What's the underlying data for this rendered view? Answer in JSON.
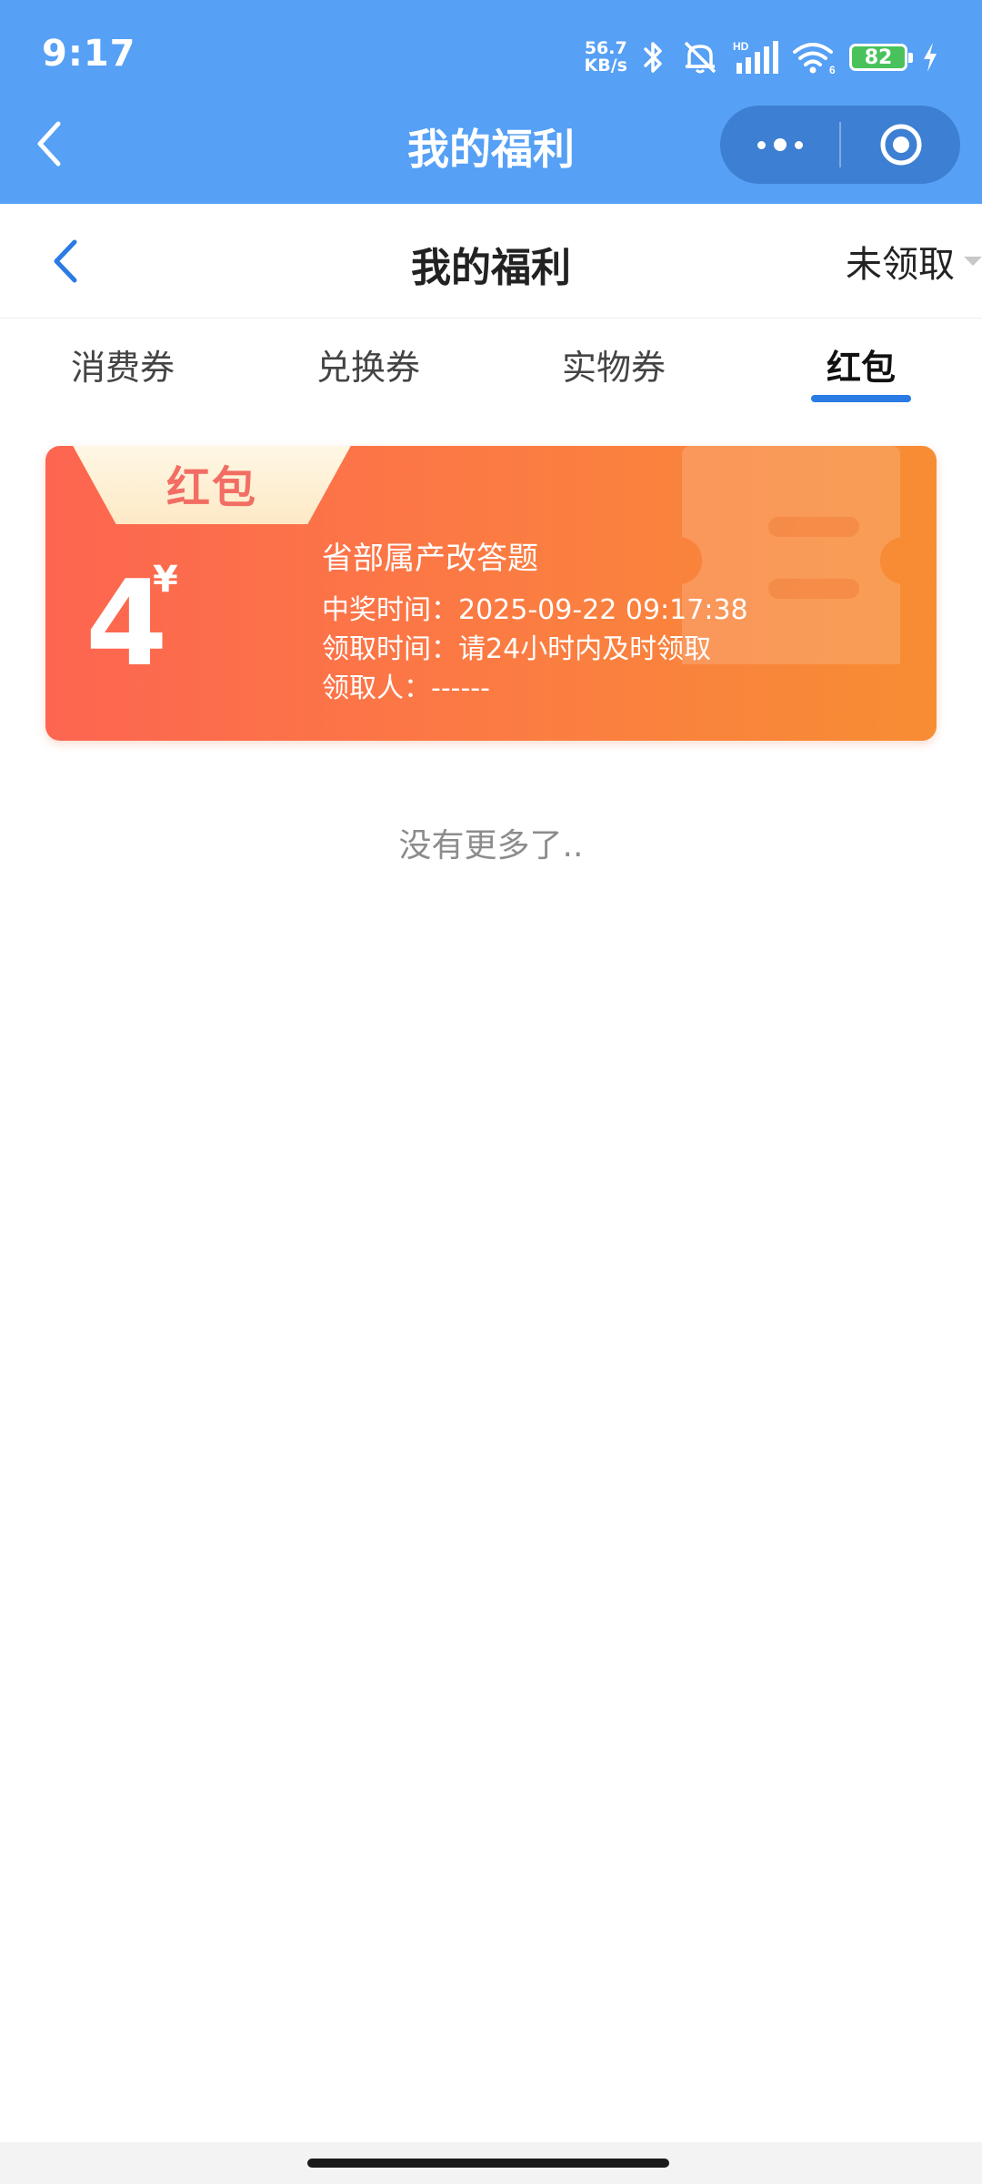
{
  "status_bar": {
    "time": "9:17",
    "net_speed_value": "56.7",
    "net_speed_unit": "KB/s",
    "battery": "82",
    "icons": [
      "bluetooth-icon",
      "mute-icon",
      "signal-icon",
      "wifi-icon",
      "battery-icon",
      "charging-icon"
    ]
  },
  "nav": {
    "title": "我的福利"
  },
  "page": {
    "title": "我的福利",
    "filter_label": "未领取"
  },
  "tabs": [
    {
      "label": "消费券"
    },
    {
      "label": "兑换券"
    },
    {
      "label": "实物券"
    },
    {
      "label": "红包"
    }
  ],
  "active_tab_index": 3,
  "card": {
    "tag": "红包",
    "amount": "4",
    "currency": "¥",
    "title": "省部属产改答题",
    "win_time": "中奖时间：2025-09-22 09:17:38",
    "claim_time": "领取时间：请24小时内及时领取",
    "claimer": "领取人：------"
  },
  "footer_text": "没有更多了..",
  "colors": {
    "header_blue": "#56a0f5",
    "capsule_blue": "#3d7fd2",
    "accent_blue": "#2a7be4",
    "card_start": "#fd6550",
    "card_end": "#f78d33"
  }
}
